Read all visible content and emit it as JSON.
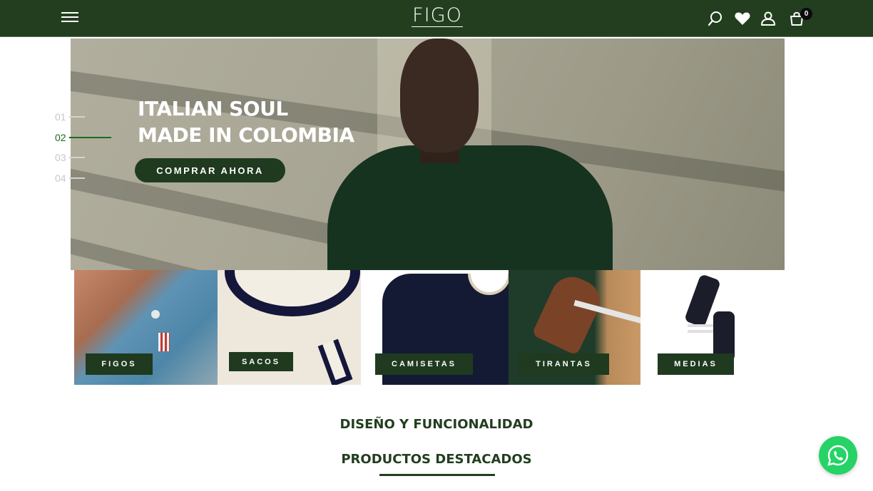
{
  "header": {
    "logo": "FIGO",
    "cart_count": "0",
    "icons": [
      "menu-icon",
      "search-icon",
      "heart-icon",
      "user-icon",
      "cart-icon"
    ],
    "background": "#223e1f"
  },
  "hero": {
    "title_line1": "ITALIAN SOUL",
    "title_line2": "MADE IN COLOMBIA",
    "cta_label": "COMPRAR AHORA"
  },
  "slider": {
    "items": [
      {
        "label": "01"
      },
      {
        "label": "02"
      },
      {
        "label": "03"
      },
      {
        "label": "04"
      }
    ],
    "active_index": 1,
    "active_color": "#1f6a1c"
  },
  "categories": [
    {
      "label": "FIGOS"
    },
    {
      "label": "SACOS"
    },
    {
      "label": "CAMISETAS"
    },
    {
      "label": "TIRANTAS"
    },
    {
      "label": "MEDIAS"
    }
  ],
  "sections": {
    "design_title": "DISEÑO Y FUNCIONALIDAD",
    "featured_title": "PRODUCTOS DESTACADOS"
  },
  "whatsapp": {
    "icon": "whatsapp-icon",
    "color": "#25d366"
  }
}
